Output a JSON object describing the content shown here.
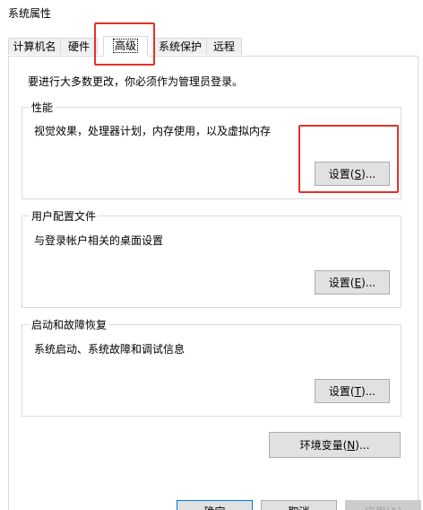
{
  "window": {
    "title": "系统属性"
  },
  "tabs": [
    {
      "label": "计算机名"
    },
    {
      "label": "硬件"
    },
    {
      "label": "高级"
    },
    {
      "label": "系统保护"
    },
    {
      "label": "远程"
    }
  ],
  "admin_note": "要进行大多数更改，你必须作为管理员登录。",
  "performance": {
    "title": "性能",
    "description": "视觉效果，处理器计划，内存使用，以及虚拟内存",
    "button": {
      "prefix": "设置(",
      "hotkey": "S",
      "suffix": ")..."
    }
  },
  "user_profiles": {
    "title": "用户配置文件",
    "description": "与登录帐户相关的桌面设置",
    "button": {
      "prefix": "设置(",
      "hotkey": "E",
      "suffix": ")..."
    }
  },
  "startup_recovery": {
    "title": "启动和故障恢复",
    "description": "系统启动、系统故障和调试信息",
    "button": {
      "prefix": "设置(",
      "hotkey": "T",
      "suffix": ")..."
    }
  },
  "env_button": {
    "prefix": "环境变量(",
    "hotkey": "N",
    "suffix": ")..."
  },
  "dialog_buttons": {
    "ok": "确定",
    "cancel": "取消",
    "apply": "应用(A)"
  },
  "highlight_color": "#e5302a"
}
